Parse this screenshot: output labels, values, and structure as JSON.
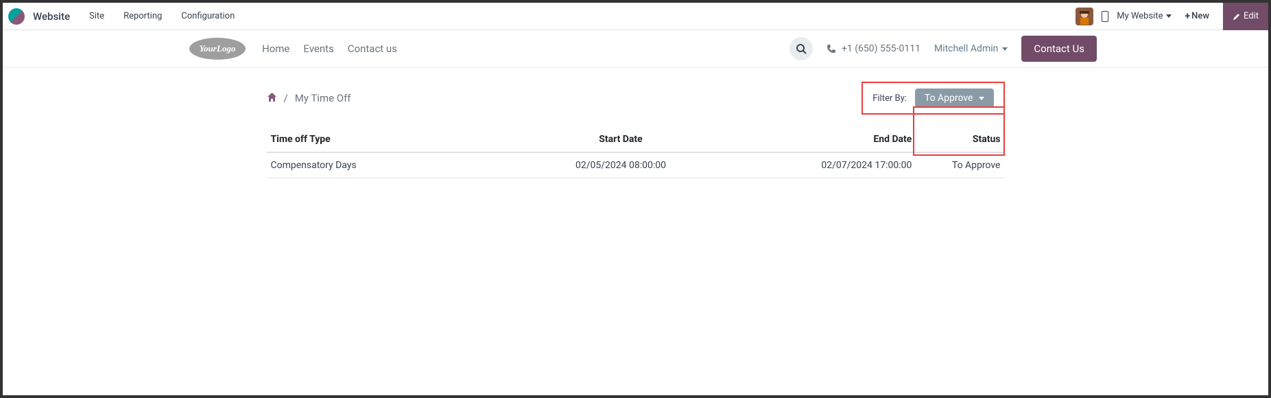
{
  "topbar": {
    "app_name": "Website",
    "menu": [
      "Site",
      "Reporting",
      "Configuration"
    ],
    "my_website": "My Website",
    "new_btn": "New",
    "edit_btn": "Edit"
  },
  "site_header": {
    "logo_text": "YourLogo",
    "nav": [
      "Home",
      "Events",
      "Contact us"
    ],
    "phone": "+1 (650) 555-0111",
    "admin": "Mitchell Admin",
    "contact_btn": "Contact Us"
  },
  "breadcrumb": {
    "current": "My Time Off"
  },
  "filter": {
    "label": "Filter By:",
    "value": "To Approve"
  },
  "table": {
    "headers": {
      "type": "Time off Type",
      "start": "Start Date",
      "end": "End Date",
      "status": "Status"
    },
    "rows": [
      {
        "type": "Compensatory Days",
        "start": "02/05/2024 08:00:00",
        "end": "02/07/2024 17:00:00",
        "status": "To Approve"
      }
    ]
  }
}
